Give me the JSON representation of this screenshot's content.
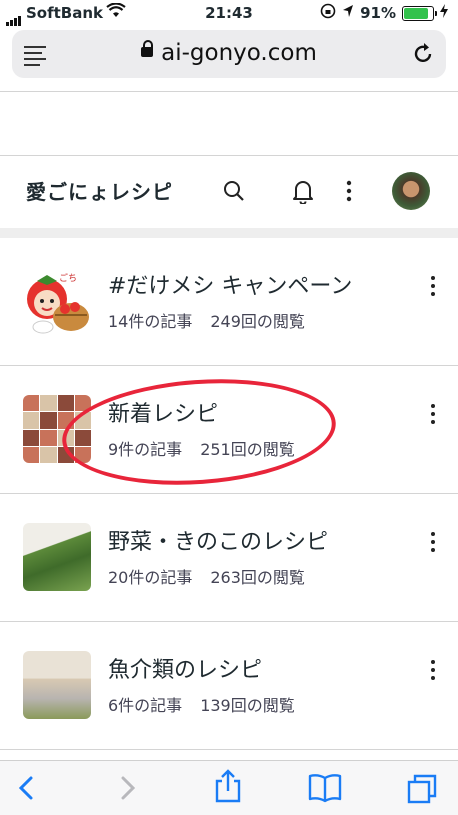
{
  "status_bar": {
    "carrier": "SoftBank",
    "time": "21:43",
    "battery": "91%",
    "battery_level": 0.91
  },
  "browser": {
    "url": "ai-gonyo.com"
  },
  "app": {
    "title": "愛ごにょレシピ"
  },
  "categories": [
    {
      "title": "#だけメシ キャンペーン",
      "articles": "14件の記事",
      "views": "249回の閲覧",
      "thumb": "tomato-character"
    },
    {
      "title": "新着レシピ",
      "articles": "9件の記事",
      "views": "251回の閲覧",
      "thumb": "recipe-collage"
    },
    {
      "title": "野菜・きのこのレシピ",
      "articles": "20件の記事",
      "views": "263回の閲覧",
      "thumb": "vegetables"
    },
    {
      "title": "魚介類のレシピ",
      "articles": "6件の記事",
      "views": "139回の閲覧",
      "thumb": "fish-prep"
    }
  ],
  "colors": {
    "highlight_circle": "#e8253a",
    "ios_blue": "#1a7cf5"
  }
}
